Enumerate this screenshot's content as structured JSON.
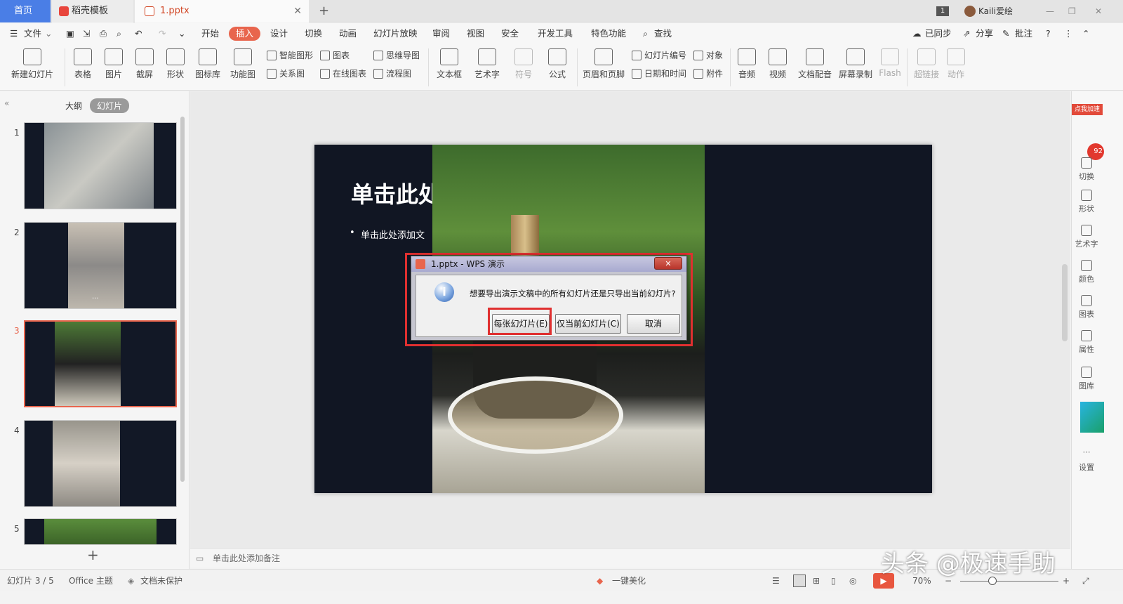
{
  "tabs": {
    "home": "首页",
    "template": "稻壳模板",
    "file": "1.pptx",
    "add": "+"
  },
  "top_right": {
    "badge": "1",
    "user": "Kaili爱绘"
  },
  "menu": {
    "file": "文件",
    "items": [
      "开始",
      "插入",
      "设计",
      "切换",
      "动画",
      "幻灯片放映",
      "审阅",
      "视图",
      "安全",
      "开发工具",
      "特色功能"
    ],
    "search": "查找",
    "sync": "已同步",
    "share": "分享",
    "annotate": "批注",
    "help": "?"
  },
  "ribbon": {
    "new_slide": "新建幻灯片",
    "table": "表格",
    "picture": "图片",
    "screenshot": "截屏",
    "shape": "形状",
    "icon_lib": "图标库",
    "func_chart": "功能图",
    "smart_shape": "智能图形",
    "chart": "图表",
    "mindmap": "思维导图",
    "relation": "关系图",
    "online_chart": "在线图表",
    "flowchart": "流程图",
    "textbox": "文本框",
    "wordart": "艺术字",
    "symbol": "符号",
    "formula": "公式",
    "header_footer": "页眉和页脚",
    "slide_number": "幻灯片编号",
    "object": "对象",
    "datetime": "日期和时间",
    "attachment": "附件",
    "audio": "音频",
    "video": "视频",
    "doc_dub": "文档配音",
    "screen_rec": "屏幕录制",
    "flash": "Flash",
    "hyperlink": "超链接",
    "action": "动作"
  },
  "left_panel": {
    "tab_outline": "大纲",
    "tab_slides": "幻灯片",
    "slides": [
      "1",
      "2",
      "3",
      "4",
      "5"
    ],
    "thumb2_label": "...",
    "add": "+"
  },
  "slide": {
    "title": "单击此处",
    "bullet": "单击此处添加文"
  },
  "notes": "单击此处添加备注",
  "right_panel": {
    "promo": "点我加速",
    "promo_num": "92",
    "items": [
      "切换",
      "形状",
      "艺术字",
      "颜色",
      "图表",
      "属性",
      "图库",
      "设置"
    ]
  },
  "dialog": {
    "title": "1.pptx - WPS 演示",
    "message": "想要导出演示文稿中的所有幻灯片还是只导出当前幻灯片?",
    "btn_all": "每张幻灯片(E)",
    "btn_current": "仅当前幻灯片(C)",
    "btn_cancel": "取消",
    "close": "✕"
  },
  "status": {
    "slide_info": "幻灯片 3 / 5",
    "theme": "Office 主题",
    "protect": "文档未保护",
    "beautify": "一键美化",
    "zoom": "70%"
  },
  "watermark": "头条 @极速手助"
}
